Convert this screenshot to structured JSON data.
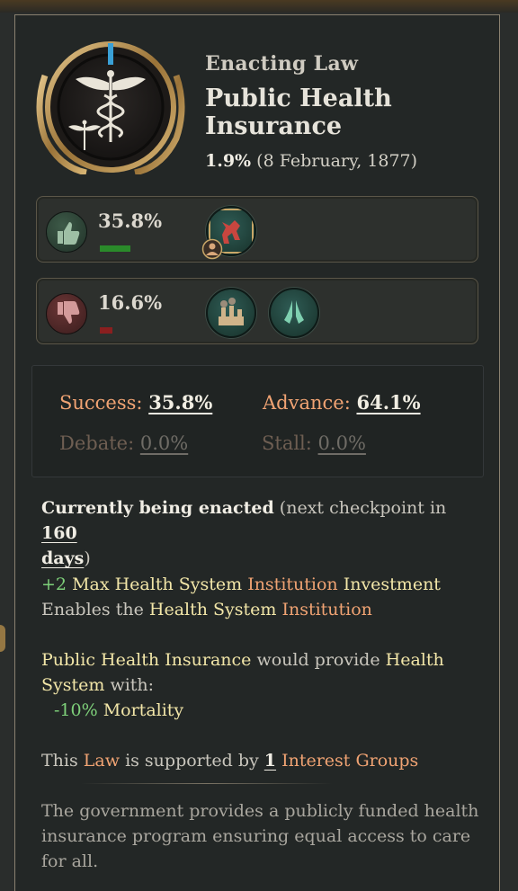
{
  "header": {
    "subtitle": "Enacting Law",
    "law_name": "Public Health Insurance",
    "progress": "1.9%",
    "date": "(8 February, 1877)"
  },
  "support": {
    "approve_pct": "35.8%",
    "oppose_pct": "16.6%",
    "approve_bar_fraction": 0.358,
    "oppose_bar_fraction": 0.166
  },
  "chances": {
    "success_label": "Success:",
    "success_value": "35.8%",
    "advance_label": "Advance:",
    "advance_value": "64.1%",
    "debate_label": "Debate:",
    "debate_value": "0.0%",
    "stall_label": "Stall:",
    "stall_value": "0.0%"
  },
  "status": {
    "enacted": "Currently being enacted",
    "pre": "(next checkpoint in",
    "days_num": "160",
    "days_word": "days",
    "close": ")"
  },
  "effects": {
    "bonus": "+2",
    "max_hs": "Max Health System",
    "institution": "Institution",
    "investment": "Investment",
    "enables": "Enables the",
    "health_system": "Health System",
    "institution2": "Institution"
  },
  "provide": {
    "law": "Public Health Insurance",
    "would_provide": "would provide",
    "health": "Health",
    "system": "System",
    "with": "with:",
    "mortality_value": "-10%",
    "mortality": "Mortality"
  },
  "supported": {
    "this": "This",
    "law": "Law",
    "mid": "is supported by",
    "count": "1",
    "groups": "Interest Groups"
  },
  "description": {
    "line1": "The government provides a publicly funded health",
    "line2": "insurance program ensuring equal access to care for all."
  },
  "icons": {
    "emblem": "caduceus-icon",
    "approve": "thumbs-up-icon",
    "oppose": "thumbs-down-icon",
    "ig_approve": [
      "trade-unions-icon"
    ],
    "ig_oppose": [
      "industrialists-icon",
      "devout-icon"
    ]
  },
  "colors": {
    "accent_orange": "#f0a373",
    "positive_green": "#7ed07a",
    "highlight_yellow": "#f2e6a8",
    "approve_bar": "#2a8a2a",
    "oppose_bar": "#8a1f1f"
  }
}
